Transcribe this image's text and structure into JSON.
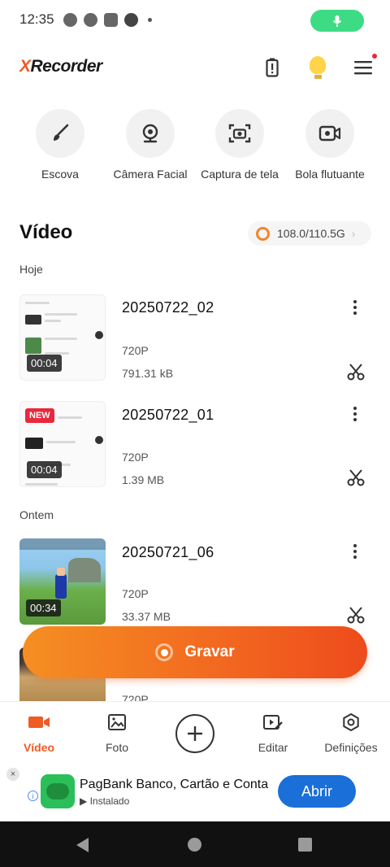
{
  "status_bar": {
    "time": "12:35",
    "notification_icons": [
      "whatsapp-icon",
      "messenger-icon",
      "instagram-icon",
      "circle-icon"
    ],
    "mic_pill_color": "#3ddc84"
  },
  "header": {
    "logo_x": "X",
    "logo_rest": "Recorder",
    "icons": [
      "battery-saver-icon",
      "tips-bulb-icon",
      "menu-icon"
    ],
    "accent_color": "#f05a24"
  },
  "tools": [
    {
      "label": "Escova",
      "icon": "brush-icon"
    },
    {
      "label": "Câmera Facial",
      "icon": "webcam-icon"
    },
    {
      "label": "Captura de tela",
      "icon": "screenshot-camera-icon"
    },
    {
      "label": "Bola flutuante",
      "icon": "floating-video-icon"
    }
  ],
  "video_section": {
    "title": "Vídeo",
    "storage": "108.0/110.5G",
    "groups": [
      {
        "label": "Hoje",
        "items": [
          {
            "name": "20250722_02",
            "resolution": "720P",
            "size": "791.31 kB",
            "duration": "00:04",
            "new": false
          },
          {
            "name": "20250722_01",
            "resolution": "720P",
            "size": "1.39 MB",
            "duration": "00:04",
            "new": true,
            "new_label": "NEW"
          }
        ]
      },
      {
        "label": "Ontem",
        "items": [
          {
            "name": "20250721_06",
            "resolution": "720P",
            "size": "33.37 MB",
            "duration": "00:34",
            "new": false
          },
          {
            "name": "",
            "resolution": "720P",
            "size": "",
            "duration": "",
            "new": false
          }
        ]
      }
    ]
  },
  "record_button": {
    "label": "Gravar"
  },
  "bottom_nav": [
    {
      "label": "Vídeo",
      "icon": "video-camera-icon",
      "active": true
    },
    {
      "label": "Foto",
      "icon": "photo-icon",
      "active": false
    },
    {
      "label": "",
      "icon": "plus-icon",
      "active": false
    },
    {
      "label": "Editar",
      "icon": "edit-video-icon",
      "active": false
    },
    {
      "label": "Definições",
      "icon": "settings-icon",
      "active": false
    }
  ],
  "ad": {
    "title": "PagBank Banco, Cartão e Conta",
    "status": "Instalado",
    "button": "Abrir",
    "close": "×",
    "info": "i"
  }
}
